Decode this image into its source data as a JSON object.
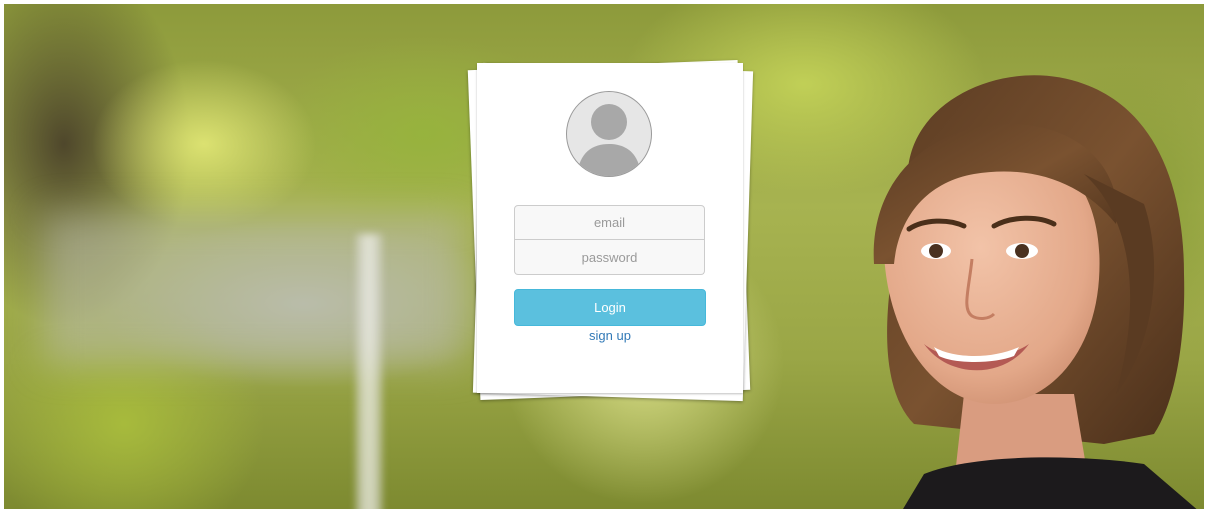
{
  "login": {
    "email_placeholder": "email",
    "password_placeholder": "password",
    "login_label": "Login",
    "signup_label": "sign up"
  },
  "icons": {
    "avatar": "user-avatar-icon"
  },
  "colors": {
    "login_button": "#5bc0de",
    "signup_link": "#337ab7",
    "card": "#ffffff"
  }
}
